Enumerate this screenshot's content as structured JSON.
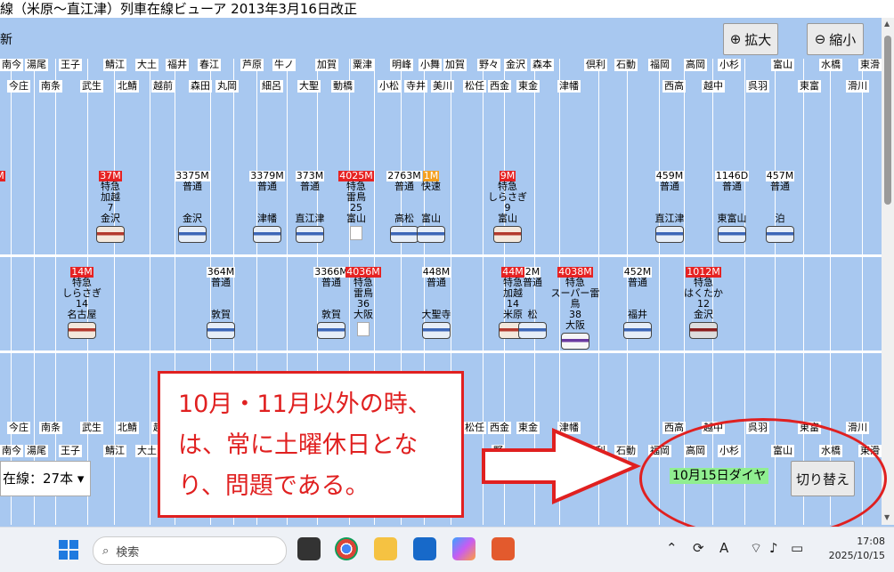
{
  "window": {
    "title": "線（米原～直江津）列車在線ビューア 2013年3月16日改正"
  },
  "toolbar": {
    "left_label": "新",
    "zoom_in_label": "拡大",
    "zoom_out_label": "縮小"
  },
  "stations_row1": [
    "南今",
    "湯尾",
    "王子",
    "鯖江",
    "大土",
    "福井",
    "春江",
    "芦原",
    "牛ノ",
    "加賀",
    "粟津",
    "明峰",
    "小舞",
    "加賀",
    "野々",
    "金沢",
    "森本",
    "倶利",
    "石動",
    "福岡",
    "高岡",
    "小杉",
    "富山",
    "水橋",
    "東滑"
  ],
  "stations_row2": [
    "今庄",
    "南条",
    "武生",
    "北鯖",
    "越前",
    "森田",
    "丸岡",
    "細呂",
    "大聖",
    "動橋",
    "小松",
    "寺井",
    "美川",
    "松任",
    "西金",
    "東金",
    "津幡",
    "西高",
    "越中",
    "呉羽",
    "東富",
    "滑川"
  ],
  "stations_row3": [
    "今庄",
    "南条",
    "武生",
    "北鯖",
    "越",
    "松任",
    "西金",
    "東金",
    "津幡",
    "西高",
    "越中",
    "呉羽",
    "東富",
    "滑川"
  ],
  "stations_row4": [
    "南今",
    "湯尾",
    "王子",
    "鯖江",
    "大土",
    "野",
    "倶利",
    "石動",
    "福岡",
    "高岡",
    "小杉",
    "富山",
    "水橋",
    "東滑"
  ],
  "upper_trains": [
    {
      "num": "M",
      "type": "",
      "line3": "",
      "dest": "",
      "style": "red",
      "car": "none"
    },
    {
      "num": "37M",
      "type": "特急",
      "line3": "加越",
      "line4": "7",
      "dest": "金沢",
      "style": "red",
      "car": "ltd"
    },
    {
      "num": "3375M",
      "type": "普通",
      "line3": "",
      "line4": "",
      "dest": "金沢",
      "style": "white",
      "car": "local"
    },
    {
      "num": "3379M",
      "type": "普通",
      "line3": "",
      "line4": "",
      "dest": "津幡",
      "style": "white",
      "car": "local"
    },
    {
      "num": "373M",
      "type": "普通",
      "line3": "",
      "line4": "",
      "dest": "直江津",
      "style": "white",
      "car": "local"
    },
    {
      "num": "4025M",
      "type": "特急",
      "line3": "雷鳥",
      "line4": "25",
      "dest": "富山",
      "style": "red",
      "car": "broken"
    },
    {
      "num": "2763M",
      "type": "普通",
      "line3": "",
      "line4": "",
      "dest": "高松",
      "style": "white",
      "car": "local"
    },
    {
      "num": "1M",
      "type": "快速",
      "line3": "",
      "line4": "",
      "dest": "富山",
      "style": "orange",
      "car": "local"
    },
    {
      "num": "9M",
      "type": "特急",
      "line3": "しらさぎ",
      "line4": "9",
      "dest": "富山",
      "style": "red",
      "car": "ltd"
    },
    {
      "num": "459M",
      "type": "普通",
      "line3": "",
      "line4": "",
      "dest": "直江津",
      "style": "white",
      "car": "local"
    },
    {
      "num": "1146D",
      "type": "普通",
      "line3": "",
      "line4": "",
      "dest": "東富山",
      "style": "white",
      "car": "local"
    },
    {
      "num": "457M",
      "type": "普通",
      "line3": "",
      "line4": "",
      "dest": "泊",
      "style": "white",
      "car": "local"
    }
  ],
  "lower_trains": [
    {
      "num": "14M",
      "type": "特急",
      "line3": "しらさぎ",
      "line4": "14",
      "dest": "名古屋",
      "style": "red",
      "car": "ltd"
    },
    {
      "num": "364M",
      "type": "普通",
      "line3": "",
      "line4": "",
      "dest": "敦賀",
      "style": "white",
      "car": "local"
    },
    {
      "num": "3366M",
      "type": "普通",
      "line3": "",
      "line4": "",
      "dest": "敦賀",
      "style": "white",
      "car": "local"
    },
    {
      "num": "4036M",
      "type": "特急",
      "line3": "雷鳥",
      "line4": "36",
      "dest": "大阪",
      "style": "red",
      "car": "broken"
    },
    {
      "num": "448M",
      "type": "普通",
      "line3": "",
      "line4": "",
      "dest": "大聖寺",
      "style": "white",
      "car": "local"
    },
    {
      "num": "44M",
      "type": "特急",
      "line3": "加越",
      "line4": "14",
      "dest": "米原",
      "style": "red",
      "car": "ltd"
    },
    {
      "num": "2M",
      "type": "普通",
      "line3": "",
      "line4": "",
      "dest": "松",
      "style": "white",
      "car": "local"
    },
    {
      "num": "4038M",
      "type": "特急",
      "line3": "スーパー雷鳥",
      "line4": "38",
      "dest": "大阪",
      "style": "red",
      "car": "sp"
    },
    {
      "num": "452M",
      "type": "普通",
      "line3": "",
      "line4": "",
      "dest": "福井",
      "style": "white",
      "car": "local"
    },
    {
      "num": "1012M",
      "type": "特急",
      "line3": "はくたか",
      "line4": "12",
      "dest": "金沢",
      "style": "red",
      "car": "hk"
    }
  ],
  "footer": {
    "count_label": "在線：27本 ▾",
    "daia_label": "10月15日ダイヤ",
    "switch_label": "切り替え"
  },
  "callout": {
    "line1": "10月・11月以外の時、",
    "line2": "は、常に土曜休日とな",
    "line3": "り、問題である。"
  },
  "taskbar": {
    "search_placeholder": "検索",
    "time": "17:08",
    "date": "2025/10/15",
    "ime": "A"
  }
}
